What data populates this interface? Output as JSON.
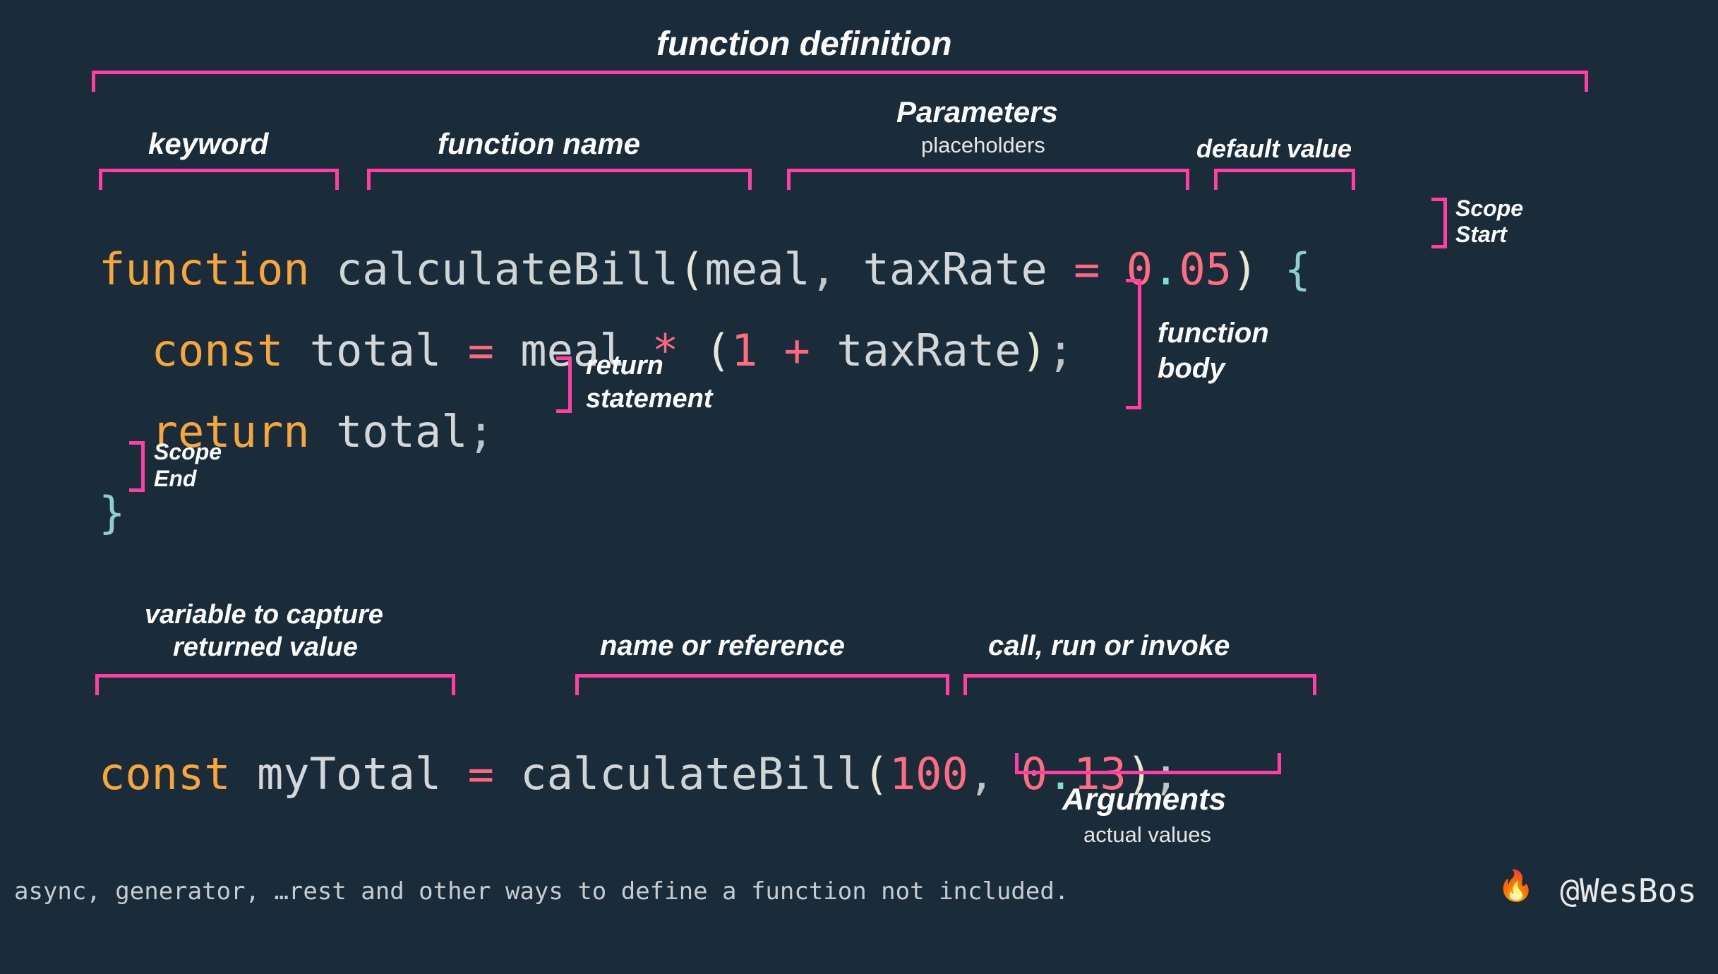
{
  "labels": {
    "function_definition": "function definition",
    "keyword": "keyword",
    "function_name": "function name",
    "parameters": "Parameters",
    "parameters_sub": "placeholders",
    "default_value": "default value",
    "scope_start_1": "Scope",
    "scope_start_2": "Start",
    "function_body_1": "function",
    "function_body_2": "body",
    "return_1": "return",
    "return_2": "statement",
    "scope_end_1": "Scope",
    "scope_end_2": "End",
    "variable_capture_1": "variable to capture",
    "variable_capture_2": "returned value",
    "name_or_reference": "name or reference",
    "call_run_invoke": "call, run or invoke",
    "arguments": "Arguments",
    "arguments_sub": "actual values"
  },
  "code": {
    "line1": {
      "function": "function",
      "sp1": " ",
      "fname": "calculateBill",
      "lparen": "(",
      "param1": "meal",
      "comma": ", ",
      "param2": "taxRate",
      "sp2": " ",
      "eq": "=",
      "sp3": " ",
      "d0": "0",
      "ddot": ".",
      "d05": "05",
      "rparen": ")",
      "sp4": " ",
      "lbrace": "{"
    },
    "line2": {
      "indent": "  ",
      "const": "const",
      "sp1": " ",
      "total": "total",
      "sp2": " ",
      "eq": "=",
      "sp3": " ",
      "meal": "meal",
      "sp4": " ",
      "star": "*",
      "sp5": " ",
      "lparen": "(",
      "one": "1",
      "sp6": " ",
      "plus": "+",
      "sp7": " ",
      "tax": "taxRate",
      "rparen": ")",
      "semi": ";"
    },
    "line3": {
      "indent": "  ",
      "return": "return",
      "sp1": " ",
      "total": "total",
      "semi": ";"
    },
    "line4": {
      "rbrace": "}"
    },
    "call": {
      "const": "const",
      "sp1": " ",
      "var": "myTotal",
      "sp2": " ",
      "eq": "=",
      "sp3": " ",
      "fname": "calculateBill",
      "lparen": "(",
      "a1": "100",
      "comma": ", ",
      "a2_0": "0",
      "a2_dot": ".",
      "a2_13": "13",
      "rparen": ")",
      "semi": ";"
    }
  },
  "footer": {
    "note": "async, generator, …rest and other ways to define a function not included.",
    "fire": "🔥",
    "handle": "@WesBos"
  }
}
